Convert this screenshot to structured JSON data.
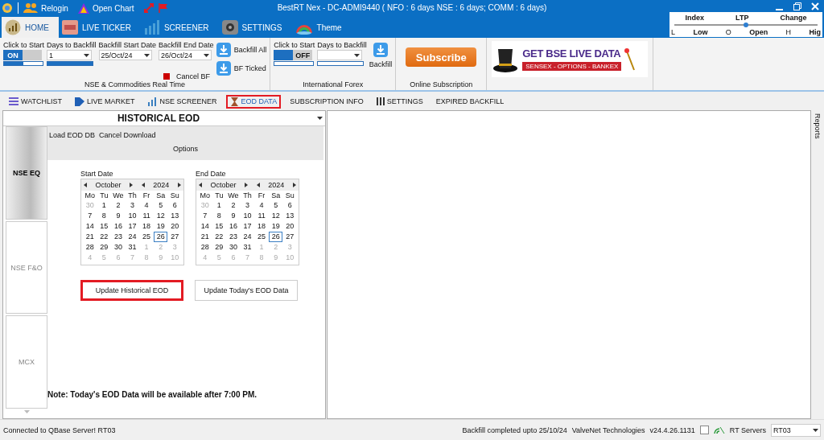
{
  "title_bar": {
    "title": "BestRT Nex - DC-ADMI9440 ( NFO : 6 days NSE : 6 days; COMM : 6 days)",
    "actions": [
      {
        "label": "Relogin",
        "kind": "people"
      },
      {
        "label": "Open Chart",
        "kind": "chart"
      }
    ]
  },
  "ticker": {
    "columns": [
      "Index",
      "LTP",
      "Change"
    ],
    "level": 0.5,
    "marks": [
      {
        "key": "L",
        "label": "Low"
      },
      {
        "key": "O",
        "label": "Open"
      },
      {
        "key": "H",
        "label": "Hig"
      }
    ]
  },
  "main_tabs": [
    {
      "label": "HOME",
      "selected": true,
      "kind": "home"
    },
    {
      "label": "LIVE TICKER",
      "selected": false,
      "kind": "ticker"
    },
    {
      "label": "SCREENER",
      "selected": false,
      "kind": "screener"
    },
    {
      "label": "SETTINGS",
      "selected": false,
      "kind": "settings"
    },
    {
      "label": "Theme",
      "selected": false,
      "kind": "theme"
    }
  ],
  "ribbon": {
    "nse": {
      "group_label": "NSE & Commodities Real Time",
      "start_label": "Click to Start",
      "toggle": {
        "label": "ON",
        "on": true,
        "level": 0.5
      },
      "days_label": "Days to Backfill",
      "days": {
        "value": "1",
        "level": 1
      },
      "start_date_label": "Backfill Start Date",
      "start_date": "25/Oct/24",
      "end_date_label": "Backfill End Date",
      "end_date": "26/Oct/24",
      "buttons": [
        "Backfill All",
        "BF Ticked"
      ],
      "cancel": "Cancel BF"
    },
    "forex": {
      "group_label": "International Forex",
      "start_label": "Click to Start",
      "toggle": {
        "label": "OFF",
        "on": false,
        "level": 0
      },
      "days_label": "Days to Backfill",
      "days": {
        "level": 0
      },
      "button": "Backfill"
    },
    "subscription": {
      "group_label": "Online Subscription",
      "button": "Subscribe"
    },
    "banner": {
      "headline": "GET BSE LIVE DATA",
      "strip": "SENSEX - OPTIONS - BANKEX"
    }
  },
  "sub_tabs": [
    {
      "label": "WATCHLIST",
      "selected": false,
      "highlighted": false,
      "kind": "list"
    },
    {
      "label": "LIVE MARKET",
      "selected": false,
      "highlighted": false,
      "kind": "market"
    },
    {
      "label": "NSE SCREENER",
      "selected": false,
      "highlighted": false,
      "kind": "bars"
    },
    {
      "label": "EOD DATA",
      "selected": true,
      "highlighted": true,
      "kind": "eod"
    },
    {
      "label": "SUBSCRIPTION INFO",
      "selected": false,
      "highlighted": false,
      "kind": "none"
    },
    {
      "label": "SETTINGS",
      "selected": false,
      "highlighted": false,
      "kind": "settings"
    },
    {
      "label": "EXPIRED BACKFILL",
      "selected": false,
      "highlighted": false,
      "kind": "none"
    }
  ],
  "side_label": "Reports",
  "eod_panel": {
    "header": "HISTORICAL EOD",
    "exchange_tabs": [
      {
        "label": "NSE EQ",
        "selected": true
      },
      {
        "label": "NSE F&O",
        "selected": false
      },
      {
        "label": "MCX",
        "selected": false
      }
    ],
    "menu": [
      "Load EOD DB",
      "Cancel Download"
    ],
    "options_label": "Options",
    "calendars": [
      {
        "label": "Start Date",
        "month": "October",
        "year": "2024",
        "weekdays": [
          "Mo",
          "Tu",
          "We",
          "Th",
          "Fr",
          "Sa",
          "Su"
        ],
        "weeks": [
          [
            {
              "d": "30",
              "muted": true,
              "selected": false
            },
            {
              "d": "1",
              "muted": false,
              "selected": false
            },
            {
              "d": "2",
              "muted": false,
              "selected": false
            },
            {
              "d": "3",
              "muted": false,
              "selected": false
            },
            {
              "d": "4",
              "muted": false,
              "selected": false
            },
            {
              "d": "5",
              "muted": false,
              "selected": false
            },
            {
              "d": "6",
              "muted": false,
              "selected": false
            }
          ],
          [
            {
              "d": "7",
              "muted": false,
              "selected": false
            },
            {
              "d": "8",
              "muted": false,
              "selected": false
            },
            {
              "d": "9",
              "muted": false,
              "selected": false
            },
            {
              "d": "10",
              "muted": false,
              "selected": false
            },
            {
              "d": "11",
              "muted": false,
              "selected": false
            },
            {
              "d": "12",
              "muted": false,
              "selected": false
            },
            {
              "d": "13",
              "muted": false,
              "selected": false
            }
          ],
          [
            {
              "d": "14",
              "muted": false,
              "selected": false
            },
            {
              "d": "15",
              "muted": false,
              "selected": false
            },
            {
              "d": "16",
              "muted": false,
              "selected": false
            },
            {
              "d": "17",
              "muted": false,
              "selected": false
            },
            {
              "d": "18",
              "muted": false,
              "selected": false
            },
            {
              "d": "19",
              "muted": false,
              "selected": false
            },
            {
              "d": "20",
              "muted": false,
              "selected": false
            }
          ],
          [
            {
              "d": "21",
              "muted": false,
              "selected": false
            },
            {
              "d": "22",
              "muted": false,
              "selected": false
            },
            {
              "d": "23",
              "muted": false,
              "selected": false
            },
            {
              "d": "24",
              "muted": false,
              "selected": false
            },
            {
              "d": "25",
              "muted": false,
              "selected": false
            },
            {
              "d": "26",
              "muted": false,
              "selected": true
            },
            {
              "d": "27",
              "muted": false,
              "selected": false
            }
          ],
          [
            {
              "d": "28",
              "muted": false,
              "selected": false
            },
            {
              "d": "29",
              "muted": false,
              "selected": false
            },
            {
              "d": "30",
              "muted": false,
              "selected": false
            },
            {
              "d": "31",
              "muted": false,
              "selected": false
            },
            {
              "d": "1",
              "muted": true,
              "selected": false
            },
            {
              "d": "2",
              "muted": true,
              "selected": false
            },
            {
              "d": "3",
              "muted": true,
              "selected": false
            }
          ],
          [
            {
              "d": "4",
              "muted": true,
              "selected": false
            },
            {
              "d": "5",
              "muted": true,
              "selected": false
            },
            {
              "d": "6",
              "muted": true,
              "selected": false
            },
            {
              "d": "7",
              "muted": true,
              "selected": false
            },
            {
              "d": "8",
              "muted": true,
              "selected": false
            },
            {
              "d": "9",
              "muted": true,
              "selected": false
            },
            {
              "d": "10",
              "muted": true,
              "selected": false
            }
          ]
        ]
      },
      {
        "label": "End Date",
        "month": "October",
        "year": "2024",
        "weekdays": [
          "Mo",
          "Tu",
          "We",
          "Th",
          "Fr",
          "Sa",
          "Su"
        ],
        "weeks": [
          [
            {
              "d": "30",
              "muted": true,
              "selected": false
            },
            {
              "d": "1",
              "muted": false,
              "selected": false
            },
            {
              "d": "2",
              "muted": false,
              "selected": false
            },
            {
              "d": "3",
              "muted": false,
              "selected": false
            },
            {
              "d": "4",
              "muted": false,
              "selected": false
            },
            {
              "d": "5",
              "muted": false,
              "selected": false
            },
            {
              "d": "6",
              "muted": false,
              "selected": false
            }
          ],
          [
            {
              "d": "7",
              "muted": false,
              "selected": false
            },
            {
              "d": "8",
              "muted": false,
              "selected": false
            },
            {
              "d": "9",
              "muted": false,
              "selected": false
            },
            {
              "d": "10",
              "muted": false,
              "selected": false
            },
            {
              "d": "11",
              "muted": false,
              "selected": false
            },
            {
              "d": "12",
              "muted": false,
              "selected": false
            },
            {
              "d": "13",
              "muted": false,
              "selected": false
            }
          ],
          [
            {
              "d": "14",
              "muted": false,
              "selected": false
            },
            {
              "d": "15",
              "muted": false,
              "selected": false
            },
            {
              "d": "16",
              "muted": false,
              "selected": false
            },
            {
              "d": "17",
              "muted": false,
              "selected": false
            },
            {
              "d": "18",
              "muted": false,
              "selected": false
            },
            {
              "d": "19",
              "muted": false,
              "selected": false
            },
            {
              "d": "20",
              "muted": false,
              "selected": false
            }
          ],
          [
            {
              "d": "21",
              "muted": false,
              "selected": false
            },
            {
              "d": "22",
              "muted": false,
              "selected": false
            },
            {
              "d": "23",
              "muted": false,
              "selected": false
            },
            {
              "d": "24",
              "muted": false,
              "selected": false
            },
            {
              "d": "25",
              "muted": false,
              "selected": false
            },
            {
              "d": "26",
              "muted": false,
              "selected": true
            },
            {
              "d": "27",
              "muted": false,
              "selected": false
            }
          ],
          [
            {
              "d": "28",
              "muted": false,
              "selected": false
            },
            {
              "d": "29",
              "muted": false,
              "selected": false
            },
            {
              "d": "30",
              "muted": false,
              "selected": false
            },
            {
              "d": "31",
              "muted": false,
              "selected": false
            },
            {
              "d": "1",
              "muted": true,
              "selected": false
            },
            {
              "d": "2",
              "muted": true,
              "selected": false
            },
            {
              "d": "3",
              "muted": true,
              "selected": false
            }
          ],
          [
            {
              "d": "4",
              "muted": true,
              "selected": false
            },
            {
              "d": "5",
              "muted": true,
              "selected": false
            },
            {
              "d": "6",
              "muted": true,
              "selected": false
            },
            {
              "d": "7",
              "muted": true,
              "selected": false
            },
            {
              "d": "8",
              "muted": true,
              "selected": false
            },
            {
              "d": "9",
              "muted": true,
              "selected": false
            },
            {
              "d": "10",
              "muted": true,
              "selected": false
            }
          ]
        ]
      }
    ],
    "buttons": [
      {
        "label": "Update Historical EOD",
        "highlighted": true
      },
      {
        "label": "Update Today's EOD Data",
        "highlighted": false
      }
    ],
    "note": "Note: Today's EOD Data will be available after 7:00 PM."
  },
  "status_bar": {
    "connection": "Connected to QBase Server! RT03",
    "backfill": "Backfill completed upto 25/10/24",
    "company": "ValveNet Technologies",
    "version": "v24.4.26.1131",
    "checked": false,
    "servers_label": "RT Servers",
    "server": "RT03"
  }
}
